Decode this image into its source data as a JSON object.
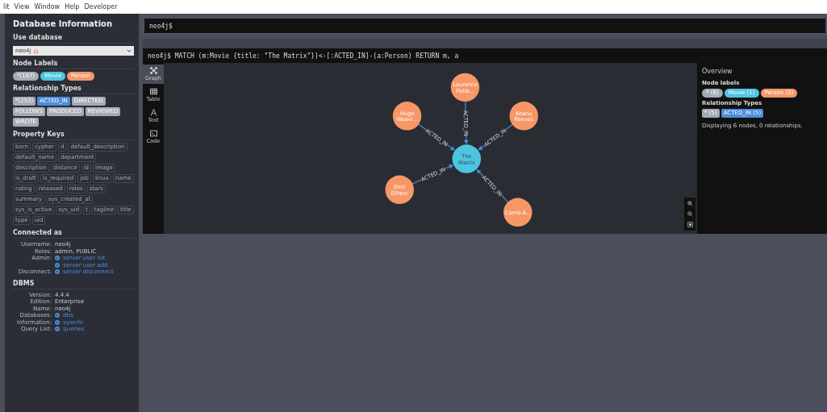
{
  "menu_bar": [
    {
      "label": "lit"
    },
    {
      "label": "View"
    },
    {
      "label": "Window"
    },
    {
      "label": "Help"
    },
    {
      "label": "Developer"
    }
  ],
  "sidebar": {
    "title": "Database Information",
    "use_database": {
      "heading": "Use database",
      "value": "neo4j"
    },
    "node_labels": {
      "heading": "Node Labels",
      "items": [
        {
          "label": "*(187)",
          "color": "#a5abb6"
        },
        {
          "label": "Movie",
          "color": "#4ec5e0"
        },
        {
          "label": "Person",
          "color": "#f79767"
        }
      ]
    },
    "relationship_types": {
      "heading": "Relationship Types",
      "items": [
        {
          "label": "*(253)",
          "color": "#a5abb6"
        },
        {
          "label": "ACTED_IN",
          "color": "#4c8eda"
        },
        {
          "label": "DIRECTED",
          "color": "#a5abb6"
        },
        {
          "label": "FOLLOWS",
          "color": "#a5abb6"
        },
        {
          "label": "PRODUCED",
          "color": "#a5abb6"
        },
        {
          "label": "REVIEWED",
          "color": "#a5abb6"
        },
        {
          "label": "WROTE",
          "color": "#a5abb6"
        }
      ]
    },
    "property_keys": {
      "heading": "Property Keys",
      "items": [
        "born",
        "cypher",
        "d",
        "default_description",
        "default_name",
        "department",
        "description",
        "distance",
        "id",
        "image",
        "is_draft",
        "is_required",
        "job",
        "linux",
        "name",
        "rating",
        "released",
        "roles",
        "stars",
        "summary",
        "sys_created_at",
        "sys_is_active",
        "sys_uid",
        "t",
        "tagline",
        "title",
        "type",
        "uid"
      ]
    },
    "connected_as": {
      "heading": "Connected as",
      "rows": [
        {
          "key": "Username:",
          "value": "neo4j",
          "kind": "text"
        },
        {
          "key": "Roles:",
          "value": "admin, PUBLIC",
          "kind": "text"
        },
        {
          "key": "Admin:",
          "value": ":server user list",
          "kind": "command"
        },
        {
          "value": ":server user add",
          "kind": "command"
        },
        {
          "key": "Disconnect:",
          "value": ":server disconnect",
          "kind": "command"
        }
      ]
    },
    "dbms": {
      "heading": "DBMS",
      "rows": [
        {
          "key": "Version:",
          "value": "4.4.4",
          "kind": "text"
        },
        {
          "key": "Edition:",
          "value": "Enterprise",
          "kind": "text"
        },
        {
          "key": "Name:",
          "value": "neo4j",
          "kind": "text"
        },
        {
          "key": "Databases:",
          "value": ":dbs",
          "kind": "command"
        },
        {
          "key": "Information:",
          "value": ":sysinfo",
          "kind": "command"
        },
        {
          "key": "Query List:",
          "value": ":queries",
          "kind": "command"
        }
      ]
    }
  },
  "editor": {
    "prompt": "neo4j$"
  },
  "result": {
    "query": "neo4j$ MATCH (m:Movie {title: \"The Matrix\"})<-[:ACTED_IN]-(a:Person) RETURN m, a",
    "views": [
      {
        "label": "Graph",
        "kind": "graph",
        "selected": true
      },
      {
        "label": "Table",
        "kind": "table",
        "selected": false
      },
      {
        "label": "Text",
        "kind": "text",
        "selected": false
      },
      {
        "label": "Code",
        "kind": "code",
        "selected": false
      }
    ],
    "graph": {
      "nodes": [
        {
          "caption": "Laurence Fishb...",
          "kind": "person",
          "color": "#f79767",
          "relationship": "ACTED_IN"
        },
        {
          "caption": "Hugo Weavi...",
          "kind": "person",
          "color": "#f79767",
          "relationship": "ACTED_IN"
        },
        {
          "caption": "Keanu Reeves",
          "kind": "person",
          "color": "#f79767",
          "relationship": "ACTED_IN"
        },
        {
          "caption": "The Matrix",
          "kind": "movie",
          "color": "#4ec5e0"
        },
        {
          "caption": "Emil Eifrem",
          "kind": "person",
          "color": "#f79767",
          "relationship": "ACTED_IN"
        },
        {
          "caption": "Carrie-A...",
          "kind": "person",
          "color": "#f79767",
          "relationship": "ACTED_IN"
        }
      ]
    },
    "overview": {
      "title": "Overview",
      "node_labels": {
        "heading": "Node labels",
        "items": [
          {
            "label": "* (6)",
            "color": "#a5abb6"
          },
          {
            "label": "Movie (1)",
            "color": "#4ec5e0"
          },
          {
            "label": "Person (5)",
            "color": "#f79767"
          }
        ]
      },
      "relationship_types": {
        "heading": "Relationship Types",
        "items": [
          {
            "label": "* (5)",
            "color": "#a5abb6"
          },
          {
            "label": "ACTED_IN (5)",
            "color": "#4c8eda"
          }
        ]
      },
      "summary": "Displaying 6 nodes, 0 relationships."
    }
  }
}
